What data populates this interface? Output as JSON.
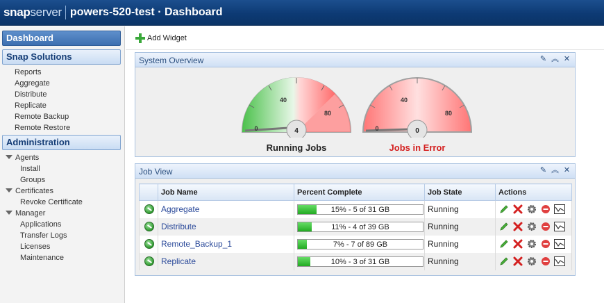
{
  "header": {
    "logo_bold": "snap",
    "logo_light": "server",
    "title": "powers-520-test · Dashboard"
  },
  "sidebar": {
    "dashboard": "Dashboard",
    "snap_solutions": "Snap Solutions",
    "solutions_items": [
      "Reports",
      "Aggregate",
      "Distribute",
      "Replicate",
      "Remote Backup",
      "Remote Restore"
    ],
    "administration": "Administration",
    "agents": "Agents",
    "agents_items": [
      "Install",
      "Groups"
    ],
    "certificates": "Certificates",
    "certificates_items": [
      "Revoke Certificate"
    ],
    "manager": "Manager",
    "manager_items": [
      "Applications",
      "Transfer Logs",
      "Licenses",
      "Maintenance"
    ]
  },
  "toolbar": {
    "add_widget": "Add Widget"
  },
  "system_overview": {
    "title": "System Overview",
    "gauges": [
      {
        "label": "Running Jobs",
        "value": "4",
        "ticks": [
          "0",
          "40",
          "80"
        ],
        "label_color": "#222222"
      },
      {
        "label": "Jobs in Error",
        "value": "0",
        "ticks": [
          "0",
          "40",
          "80"
        ],
        "label_color": "#d42020"
      }
    ]
  },
  "job_view": {
    "title": "Job View",
    "columns": [
      "Job Name",
      "Percent Complete",
      "Job State",
      "Actions"
    ],
    "rows": [
      {
        "name": "Aggregate",
        "percent": 15,
        "progress": "15% - 5 of 31 GB",
        "state": "Running"
      },
      {
        "name": "Distribute",
        "percent": 11,
        "progress": "11% - 4 of 39 GB",
        "state": "Running"
      },
      {
        "name": "Remote_Backup_1",
        "percent": 7,
        "progress": "7% - 7 of 89 GB",
        "state": "Running"
      },
      {
        "name": "Replicate",
        "percent": 10,
        "progress": "10% - 3 of 31 GB",
        "state": "Running"
      }
    ]
  },
  "colors": {
    "accent": "#0d3a74",
    "progress": "#22aa22",
    "error": "#d42020"
  }
}
